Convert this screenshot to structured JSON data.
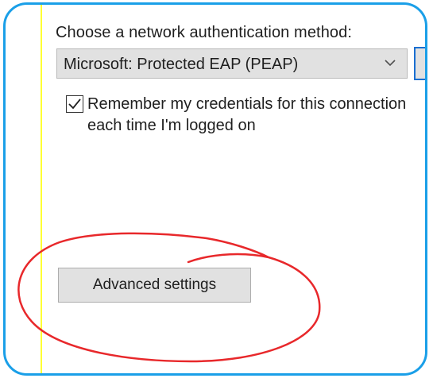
{
  "auth": {
    "method_label": "Choose a network authentication method:",
    "selected_method": "Microsoft: Protected EAP (PEAP)",
    "remember_label": "Remember my credentials for this connection each time I'm logged on",
    "remember_checked": true
  },
  "advanced_button_label": "Advanced settings",
  "colors": {
    "frame_border": "#1a9fe8",
    "annotation": "#e8282b",
    "button_face": "#e1e1e1",
    "left_rule": "#ffff33"
  }
}
